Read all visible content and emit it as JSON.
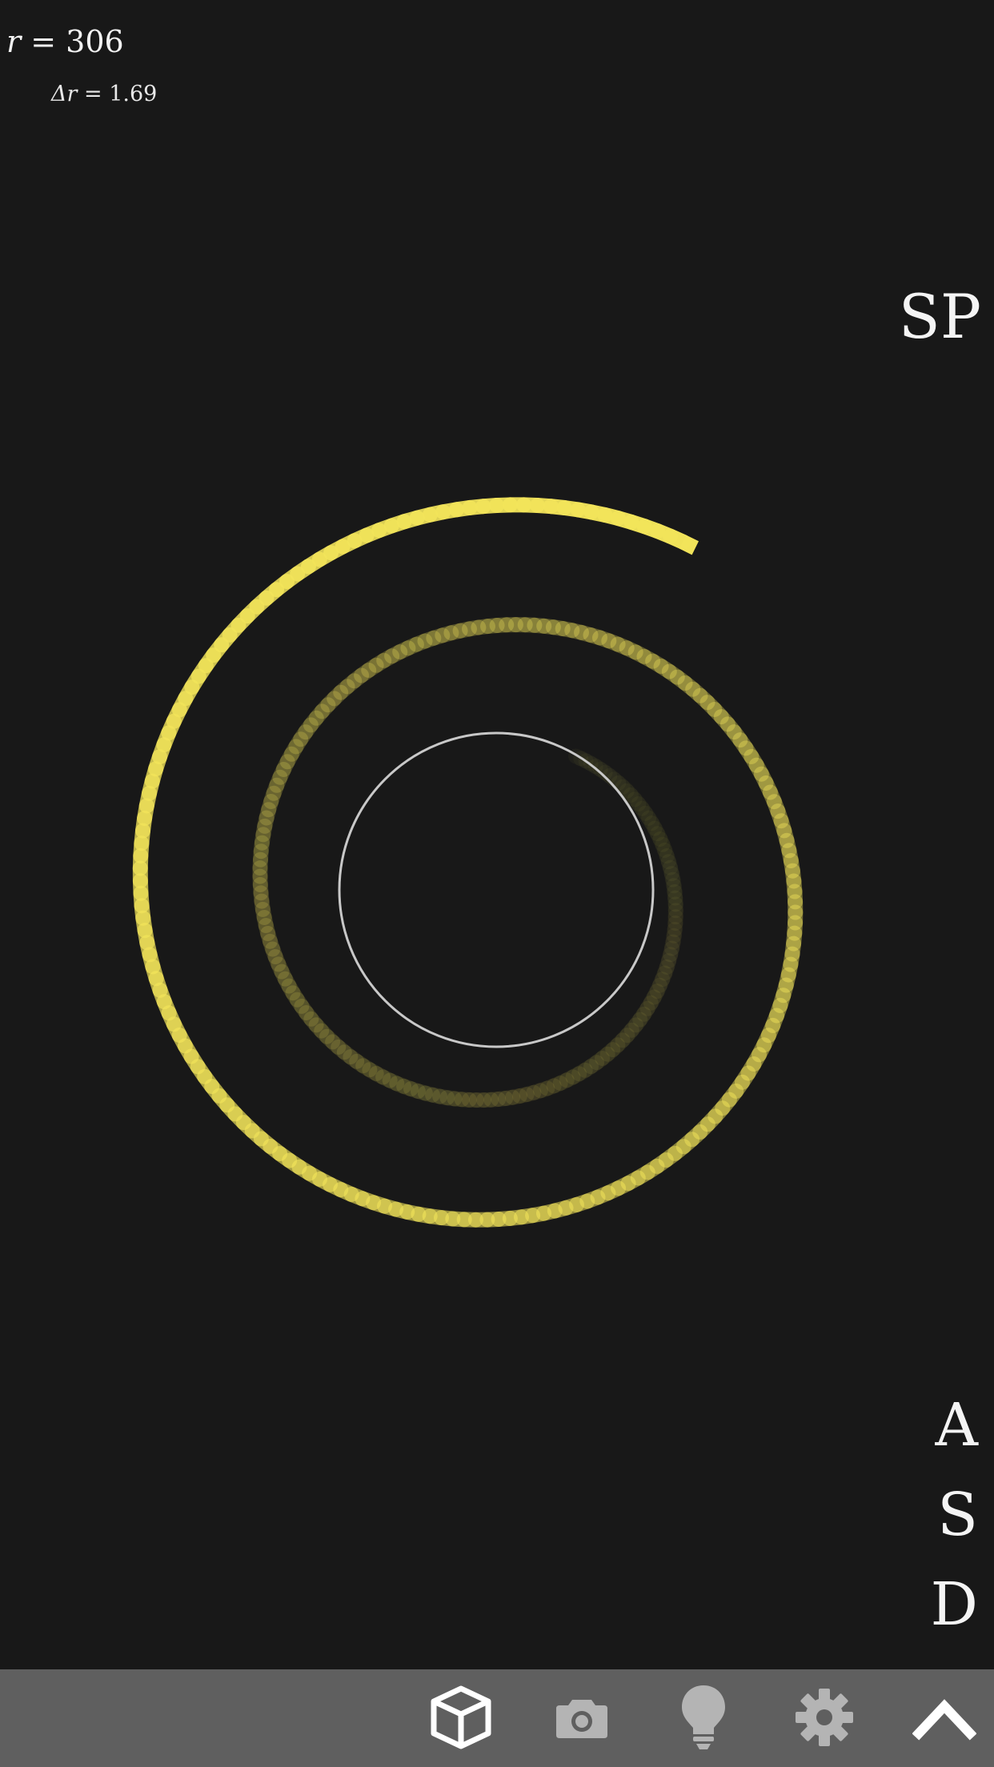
{
  "readout": {
    "r_var": "r",
    "r_eq": " = ",
    "r_value": "306",
    "dr_var": "Δr",
    "dr_eq": " = ",
    "dr_value": "1.69"
  },
  "side_buttons": {
    "sp": "SP",
    "a": "A",
    "s": "S",
    "d": "D"
  },
  "toolbar": {
    "icons": [
      "cube-icon",
      "camera-icon",
      "lightbulb-icon",
      "gear-icon",
      "chevron-up-icon"
    ]
  },
  "colors": {
    "background": "#181818",
    "toolbar": "#5f5f5f",
    "spiral": "#f2e45a",
    "circle": "#c8c8c8",
    "icon_active": "#ffffff",
    "icon_muted": "#b4b4b4"
  }
}
